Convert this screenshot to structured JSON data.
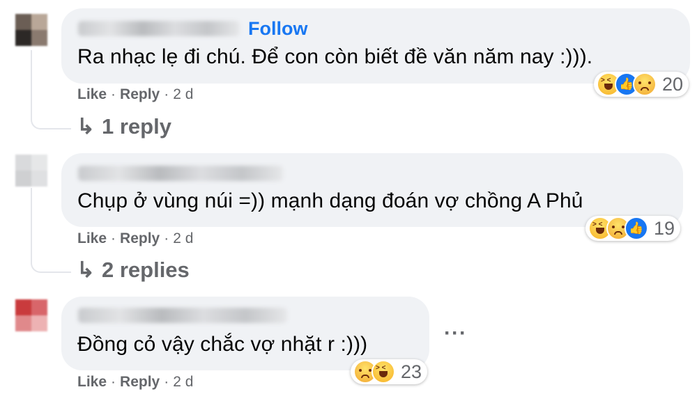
{
  "comments": [
    {
      "follow_label": "Follow",
      "text": "Ra nhạc lẹ đi chú. Để con còn biết đề văn năm nay :))).",
      "reactions": {
        "icons": [
          "haha-icon",
          "like-icon",
          "sad-icon"
        ],
        "count": "20"
      },
      "actions": {
        "like": "Like",
        "reply": "Reply",
        "sep": "·",
        "time": "2 d"
      },
      "replies": {
        "arrow": "↳",
        "label": "1 reply"
      }
    },
    {
      "text": "Chụp ở vùng núi =)) mạnh dạng đoán vợ chồng A Phủ",
      "reactions": {
        "icons": [
          "haha-icon",
          "sad-icon",
          "like-icon"
        ],
        "count": "19"
      },
      "actions": {
        "like": "Like",
        "reply": "Reply",
        "sep": "·",
        "time": "2 d"
      },
      "replies": {
        "arrow": "↳",
        "label": "2 replies"
      }
    },
    {
      "text": "Đồng cỏ vậy chắc vợ nhặt r :)))",
      "reactions": {
        "icons": [
          "sad-icon",
          "haha-icon"
        ],
        "count": "23"
      },
      "actions": {
        "like": "Like",
        "reply": "Reply",
        "sep": "·",
        "time": "2 d"
      },
      "more": "···"
    }
  ],
  "colors": {
    "bubble": "#f0f2f5",
    "link": "#1877f2",
    "meta": "#65676b",
    "text": "#050505"
  }
}
